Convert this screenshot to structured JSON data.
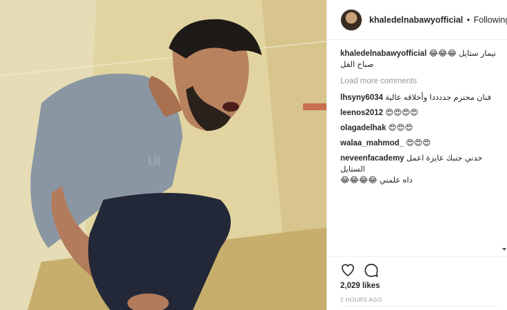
{
  "post": {
    "username": "khaledelnabawyofficial",
    "separator": "•",
    "follow_label": "Following"
  },
  "caption": {
    "user": "khaledelnabawyofficial",
    "line1": "نيمار ستايل 😂😂😂",
    "line2": "صباح الفل"
  },
  "load_more": "Load more comments",
  "comments": [
    {
      "user": "lhsyny6034",
      "text": "فنان محترم جددددا وأخلاقه عالية"
    },
    {
      "user": "leenos2012",
      "text": "😍😍😍😍"
    },
    {
      "user": "olagadelhak",
      "text": "😍😍😍"
    },
    {
      "user": "walaa_mahmod_",
      "text": "😍😍😍"
    },
    {
      "user": "neveenfacademy",
      "text": "خدني جنبك عايزة اعمل الستايل",
      "text2": "داه علمني 😂😂😂😂"
    }
  ],
  "icons": {
    "like": "heart-icon",
    "comment": "comment-icon"
  },
  "likes_text": "2,029 likes",
  "time_text": "2 HOURS AGO",
  "colors": {
    "text": "#262626",
    "muted": "#999999",
    "divider": "#efefef"
  }
}
